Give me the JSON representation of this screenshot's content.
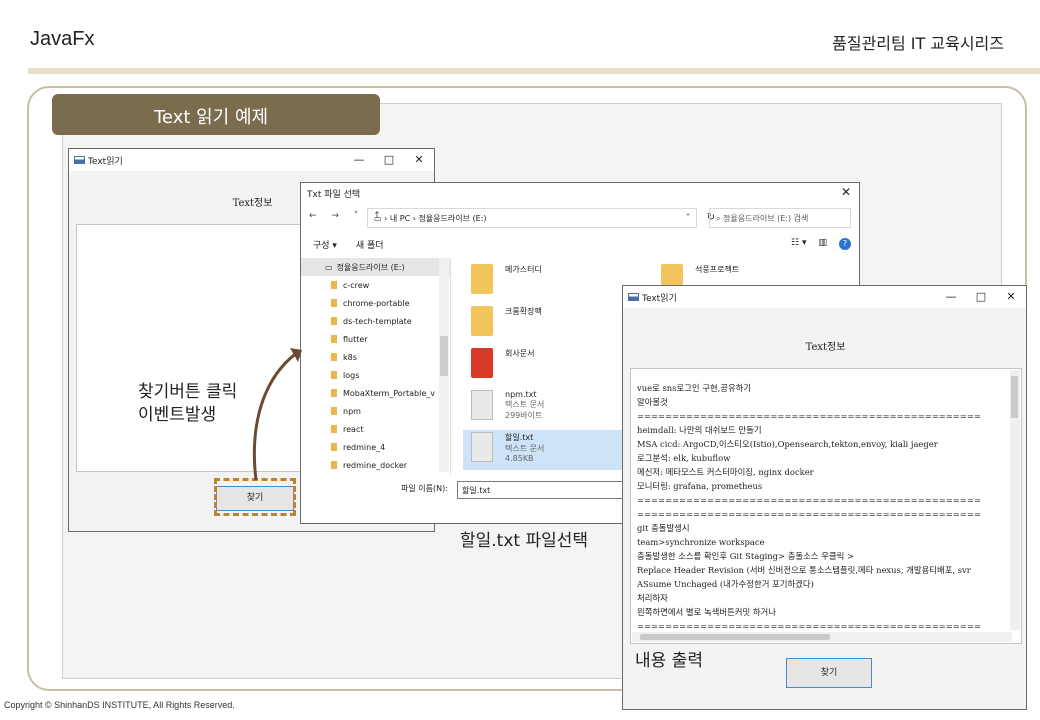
{
  "slide": {
    "left_title": "JavaFx",
    "right_title": "품질관리팀 IT 교육시리즈",
    "section_title": "Text 읽기 예제",
    "copyright": "Copyright © ShinhanDS INSTITUTE, All Rights Reserved."
  },
  "window1": {
    "title": "Text읽기",
    "controls": [
      "—",
      "□",
      "✕"
    ],
    "label": "Text정보",
    "button": "찾기"
  },
  "dialog": {
    "title": "Txt 파일 선택",
    "close": "✕",
    "nav_arrows": "← → ˅ ↑",
    "address": "› 내 PC › 정율응드라이브 (E:)",
    "address_chevron": "˅",
    "refresh": "↻",
    "search_placeholder": "정율응드라이브 (E:) 검색",
    "toolbar": [
      "구성 ▾",
      "새 폴더"
    ],
    "help": "?",
    "nav_items": [
      "정율응드라이브 (E:)",
      "c-crew",
      "chrome-portable",
      "ds-tech-template",
      "flutter",
      "k8s",
      "logs",
      "MobaXterm_Portable_v",
      "npm",
      "react",
      "redmine_4",
      "redmine_docker"
    ],
    "files": [
      {
        "name": "메가스터디",
        "meta1": "",
        "meta2": ""
      },
      {
        "name": "크롬확장팩",
        "meta1": "",
        "meta2": ""
      },
      {
        "name": "회사문서",
        "meta1": "",
        "meta2": ""
      },
      {
        "name": "npm.txt",
        "meta1": "텍스트 문서",
        "meta2": "299바이트"
      },
      {
        "name": "할일.txt",
        "meta1": "텍스트 문서",
        "meta2": "4.85KB"
      },
      {
        "name": "석풍프로젝트",
        "meta1": "",
        "meta2": ""
      }
    ],
    "filename_label": "파일 이름(N):",
    "filename_value": "할일.txt"
  },
  "window3": {
    "title": "Text읽기",
    "controls": [
      "—",
      "□",
      "✕"
    ],
    "label": "Text정보",
    "button": "찾기",
    "lines": [
      "vue로 sns로그인 구현,공유하기",
      "알아볼것",
      "=================================================",
      "heimdall: 나만의 대쉬보드 만들기",
      "MSA cicd: ArgoCD,이스티오(Istio),Opensearch,tekton,envoy, kiali jaeger",
      "로그분석: elk, kubuflow",
      "메신저: 메타모스트 커스터마이징, nginx docker",
      "모니터링: grafana, prometheus",
      "=================================================",
      "=================================================",
      "git 충돌발생시",
      "team>synchronize workspace",
      "충돌발생한 소스를 확인후 Git Staging> 충돌소스 우클릭 >",
      "Replace Header Revision (서버 신버전으로 통소스템플릿,메타 nexus, 개발용티배포, svr",
      "ASsume Unchaged (내가수정한거 포기하겠다)",
      "처리하자",
      "왼쪽하면에서 별로 녹색버튼커밋 하거나",
      "================================================="
    ]
  },
  "annotations": {
    "click_event": [
      "찾기버튼 클릭",
      "이벤트발생"
    ],
    "file_select": "할일.txt 파일선택",
    "output": "내용 출력"
  },
  "colors": {
    "accent": "#7b6c4e",
    "header_rule": "#eadfc9",
    "frame_border": "#c9bfa5",
    "dash_highlight": "#b88438",
    "selection": "#cde3f7"
  }
}
